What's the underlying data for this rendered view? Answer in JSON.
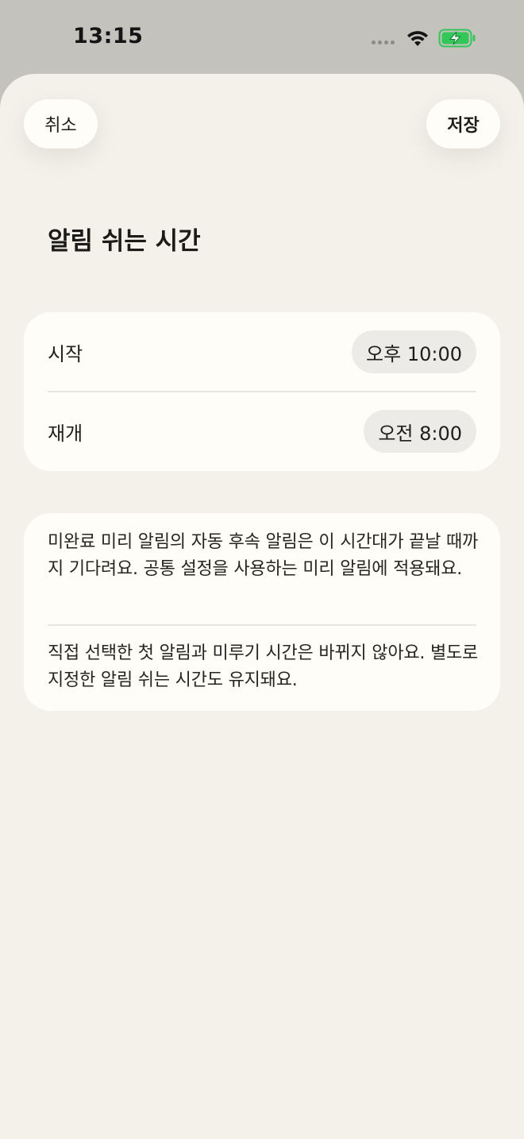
{
  "status_bar": {
    "time": "13:15",
    "battery_color": "#33c759"
  },
  "header": {
    "cancel_label": "취소",
    "save_label": "저장"
  },
  "title": "알림 쉬는 시간",
  "quiet_hours": {
    "start_label": "시작",
    "start_value": "오후 10:00",
    "resume_label": "재개",
    "resume_value": "오전 8:00"
  },
  "info": {
    "paragraph1": "미완료 미리 알림의 자동 후속 알림은 이 시간대가 끝날 때까지 기다려요. 공통 설정을 사용하는 미리 알림에 적용돼요.",
    "paragraph2": "직접 선택한 첫 알림과 미루기 시간은 바뀌지 않아요. 별도로 지정한 알림 쉬는 시간도 유지돼요."
  },
  "icons": {
    "wifi": "wifi-icon",
    "battery": "battery-charging-icon",
    "signal": "signal-dots-icon"
  }
}
